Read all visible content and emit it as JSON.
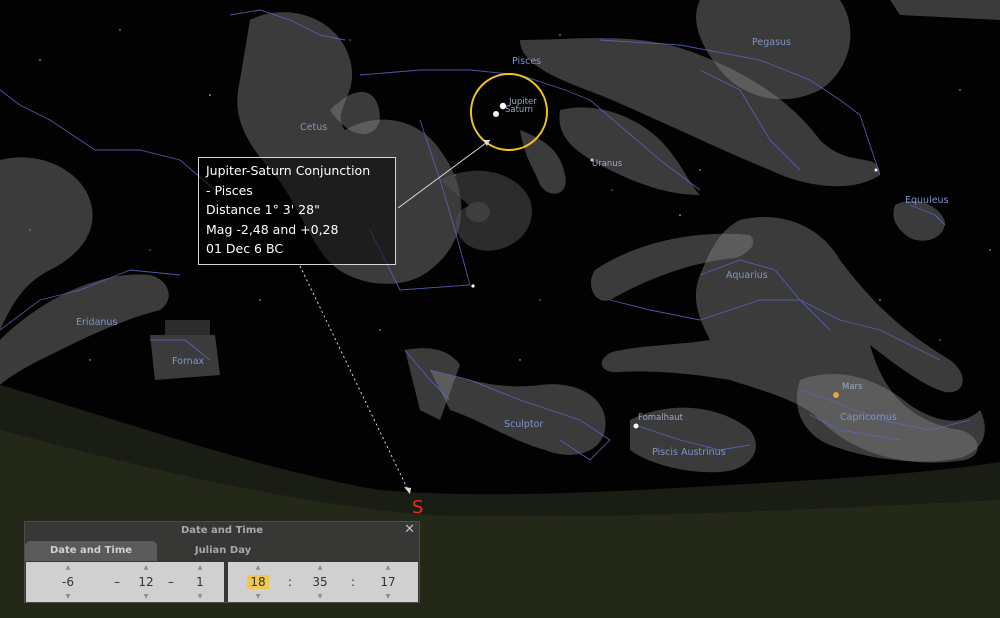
{
  "app": {
    "name": "Stellarium"
  },
  "constellations": [
    {
      "name": "Pisces"
    },
    {
      "name": "Pegasus"
    },
    {
      "name": "Cetus"
    },
    {
      "name": "Equuleus"
    },
    {
      "name": "Aquarius"
    },
    {
      "name": "Eridanus"
    },
    {
      "name": "Fornax"
    },
    {
      "name": "Sculptor"
    },
    {
      "name": "Capricornus"
    },
    {
      "name": "Piscis Austrinus"
    }
  ],
  "objects": [
    {
      "name": "Jupiter"
    },
    {
      "name": "Saturn"
    },
    {
      "name": "Uranus"
    },
    {
      "name": "Mars"
    },
    {
      "name": "Fomalhaut"
    }
  ],
  "infobox": {
    "line1": "Jupiter-Saturn Conjunction",
    "line2": "- Pisces",
    "line3": "Distance 1° 3' 28\"",
    "line4": "Mag -2,48 and +0,28",
    "line5": "01 Dec 6 BC"
  },
  "compass": {
    "direction": "S"
  },
  "datetime_window": {
    "title": "Date and Time",
    "close_glyph": "✕",
    "tabs": [
      {
        "label": "Date and Time",
        "active": true
      },
      {
        "label": "Julian Day",
        "active": false
      }
    ],
    "arrow_up": "▲",
    "arrow_down": "▼",
    "date_sep": "–",
    "time_sep": ":",
    "year": "-6",
    "month": "12",
    "day": "1",
    "hour": "18",
    "minute": "35",
    "second": "17"
  },
  "colors": {
    "highlight_circle": "#f2c21d",
    "constellation_line": "#5a66c8",
    "compass_label": "#e8321e",
    "hour_highlight": "#f0c850"
  }
}
